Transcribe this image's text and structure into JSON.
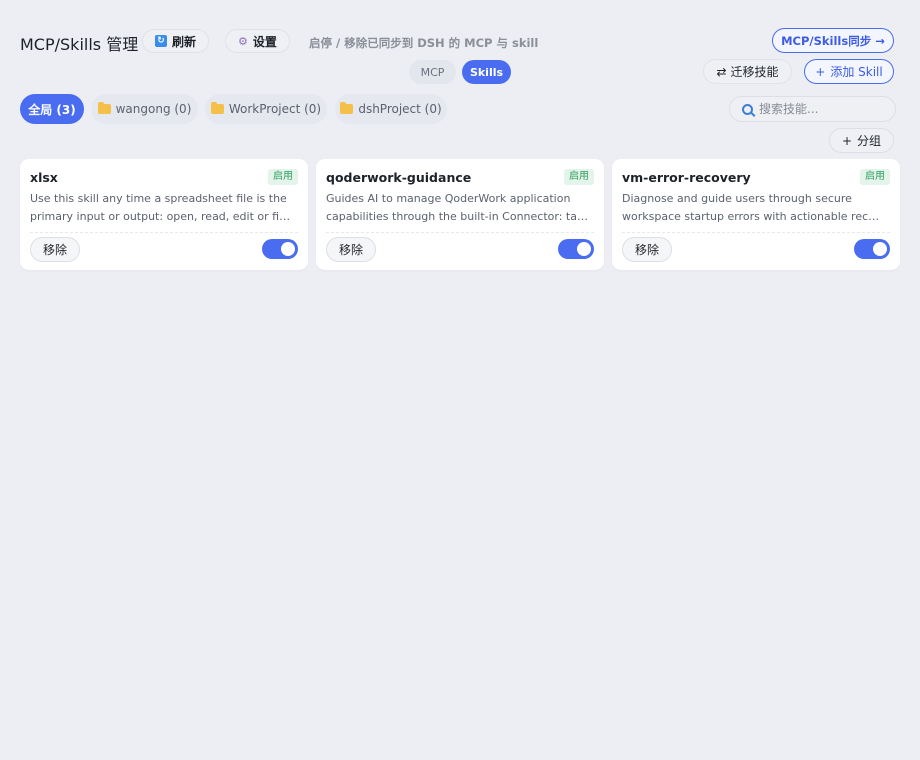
{
  "header": {
    "title": "MCP/Skills 管理",
    "refresh_label": "刷新",
    "settings_label": "设置",
    "hint": "启停 / 移除已同步到 DSH 的 MCP 与 skill",
    "sync_label": "MCP/Skills同步 →"
  },
  "mode_tabs": {
    "mcp": "MCP",
    "skills": "Skills",
    "active": "Skills"
  },
  "actions": {
    "migrate_label": "迁移技能",
    "add_label": "添加 Skill",
    "group_label": "分组"
  },
  "groups": [
    {
      "label": "全局 (3)",
      "active": true
    },
    {
      "label": "wangong (0)",
      "active": false
    },
    {
      "label": "WorkProject (0)",
      "active": false
    },
    {
      "label": "dshProject (0)",
      "active": false
    }
  ],
  "search": {
    "placeholder": "搜索技能...",
    "value": ""
  },
  "cards": [
    {
      "name": "xlsx",
      "status": "启用",
      "desc_line1": "Use this skill any time a spreadsheet file is the",
      "desc_line2": "primary input or output: open, read, edit or fix...",
      "remove_label": "移除",
      "enabled": true
    },
    {
      "name": "qoderwork-guidance",
      "status": "启用",
      "desc_line1": "Guides AI to manage QoderWork application",
      "desc_line2": "capabilities through the built-in Connector: tasks...",
      "remove_label": "移除",
      "enabled": true
    },
    {
      "name": "vm-error-recovery",
      "status": "启用",
      "desc_line1": "Diagnose and guide users through secure",
      "desc_line2": "workspace startup errors with actionable recover...",
      "remove_label": "移除",
      "enabled": true
    }
  ],
  "colors": {
    "accent": "#4a6cf0",
    "status_green": "#2f9e5c",
    "background": "#eceef3"
  }
}
